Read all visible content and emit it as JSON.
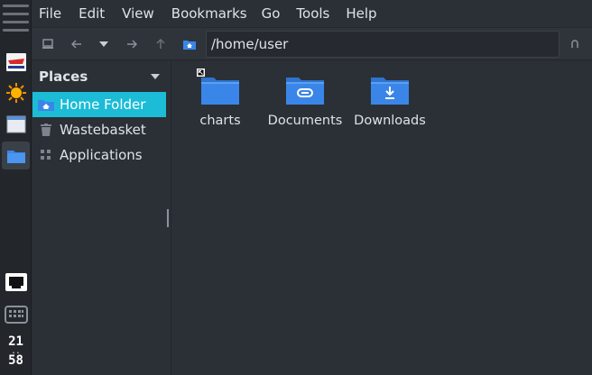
{
  "menubar": {
    "items": [
      "File",
      "Edit",
      "View",
      "Bookmarks",
      "Go",
      "Tools",
      "Help"
    ]
  },
  "toolbar": {
    "location": "/home/user"
  },
  "sidepane": {
    "title": "Places",
    "items": [
      {
        "label": "Home Folder",
        "icon": "home-folder-icon",
        "selected": true
      },
      {
        "label": "Wastebasket",
        "icon": "trash-icon",
        "selected": false
      },
      {
        "label": "Applications",
        "icon": "apps-grid-icon",
        "selected": false
      }
    ]
  },
  "files": [
    {
      "name": "charts",
      "icon": "folder-icon"
    },
    {
      "name": "Documents",
      "icon": "documents-folder-icon"
    },
    {
      "name": "Downloads",
      "icon": "downloads-folder-icon"
    }
  ],
  "dock": {
    "clock_hours": "21",
    "clock_minutes": "58"
  },
  "colors": {
    "accent": "#1cbcd6",
    "folder": "#3a86e8",
    "background": "#2b3036"
  }
}
